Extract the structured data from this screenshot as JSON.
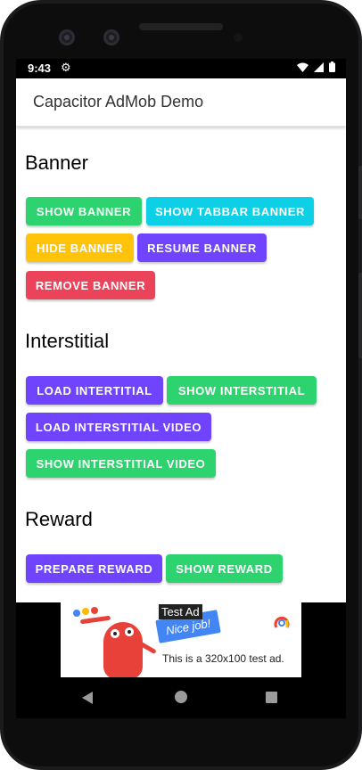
{
  "status_bar": {
    "time": "9:43",
    "gear_icon": "gear-icon",
    "icons": [
      "wifi-icon",
      "signal-icon",
      "battery-icon"
    ]
  },
  "toolbar": {
    "title": "Capacitor AdMob Demo"
  },
  "sections": {
    "banner": {
      "title": "Banner",
      "show_banner": "SHOW BANNER",
      "show_tabbar_banner": "SHOW TABBAR BANNER",
      "hide_banner": "HIDE BANNER",
      "resume_banner": "RESUME BANNER",
      "remove_banner": "REMOVE BANNER"
    },
    "interstitial": {
      "title": "Interstitial",
      "load_intertitial": "LOAD INTERTITIAL",
      "show_interstitial": "SHOW INTERSTITIAL",
      "load_interstitial_video": "LOAD INTERSTITIAL VIDEO",
      "show_interstitial_video": "SHOW INTERSTITIAL VIDEO"
    },
    "reward": {
      "title": "Reward",
      "prepare_reward": "PREPARE REWARD",
      "show_reward": "SHOW REWARD"
    }
  },
  "ad": {
    "label": "Test Ad",
    "badge_text": "Nice job!",
    "body_text": "This is a 320x100 test ad."
  },
  "colors": {
    "green": "#2dd36f",
    "cyan": "#0dcfe6",
    "yellow": "#ffc409",
    "purple": "#7044ff",
    "red": "#eb445a"
  },
  "nav_bar": {
    "icons": [
      "back-icon",
      "home-icon",
      "recents-icon"
    ]
  }
}
